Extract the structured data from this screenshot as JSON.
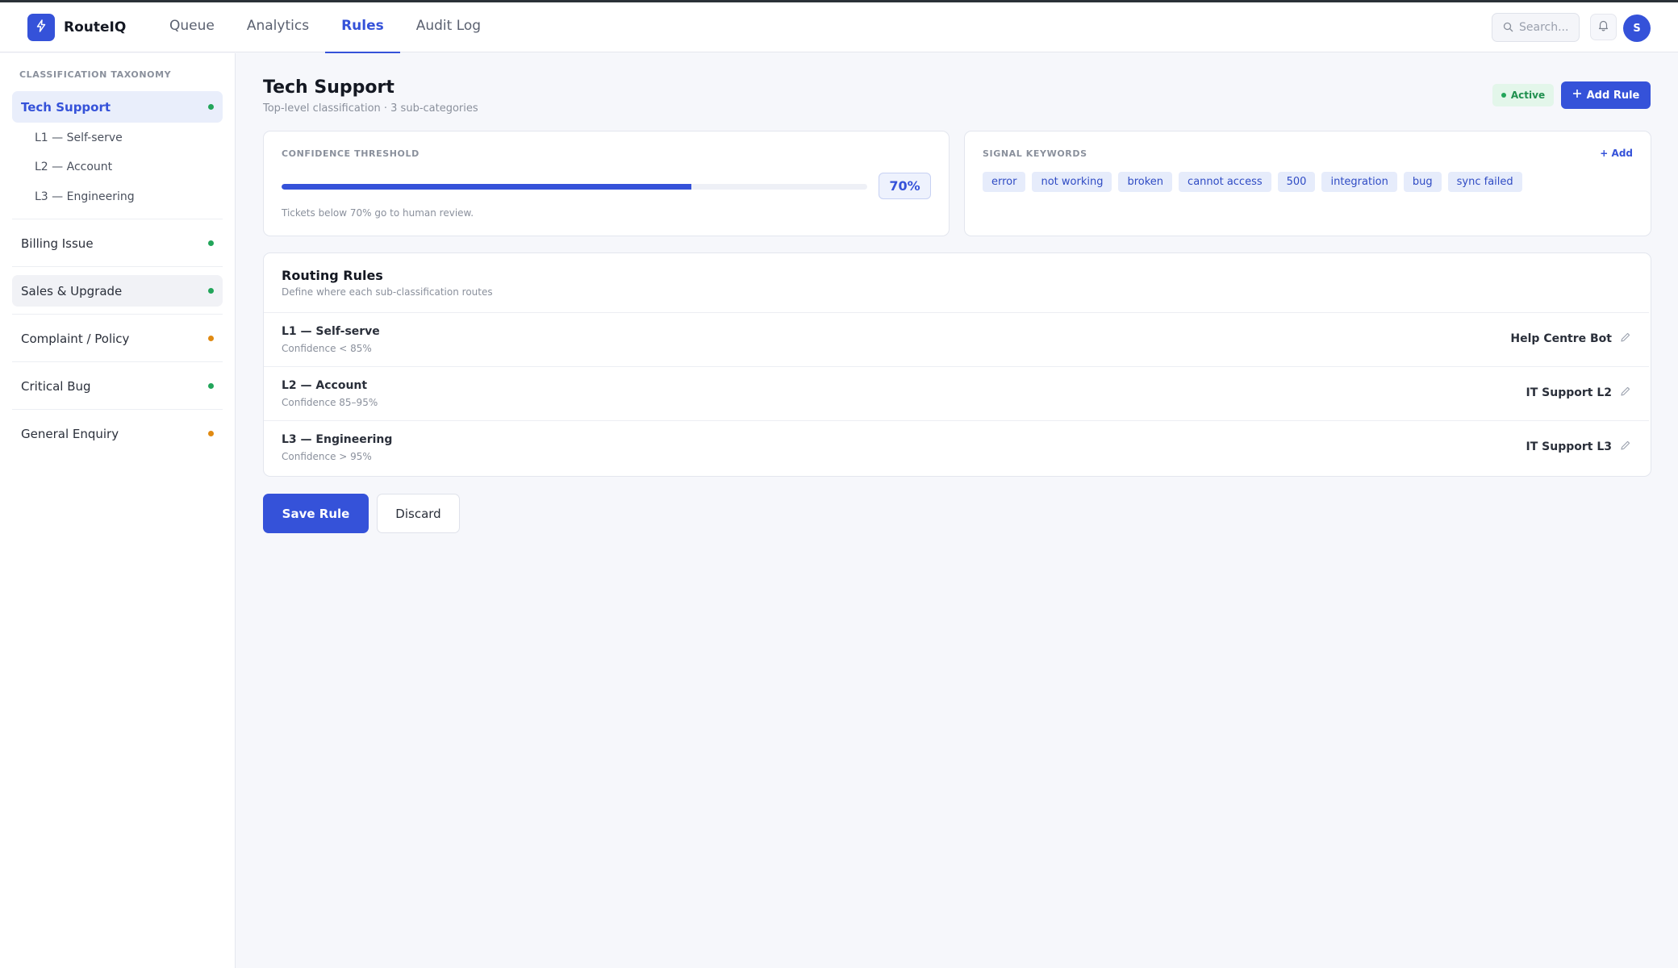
{
  "app": {
    "brand": "RouteIQ"
  },
  "colors": {
    "accent": "#3552d9",
    "active": "#22a55a",
    "warning": "#e08a12"
  },
  "nav": {
    "tabs": [
      {
        "label": "Queue",
        "active": false
      },
      {
        "label": "Analytics",
        "active": false
      },
      {
        "label": "Rules",
        "active": true
      },
      {
        "label": "Audit Log",
        "active": false
      }
    ]
  },
  "header": {
    "search_placeholder": "Search...",
    "avatar_initial": "S",
    "icons": [
      "bolt-icon",
      "search-icon",
      "bell-icon"
    ]
  },
  "sidebar": {
    "heading": "CLASSIFICATION TAXONOMY",
    "items": [
      {
        "label": "Tech Support",
        "status": "green",
        "selected": true,
        "children": [
          "L1 — Self-serve",
          "L2 — Account",
          "L3 — Engineering"
        ]
      },
      {
        "label": "Billing Issue",
        "status": "green"
      },
      {
        "label": "Sales & Upgrade",
        "status": "green"
      },
      {
        "label": "Complaint / Policy",
        "status": "orange"
      },
      {
        "label": "Critical Bug",
        "status": "green"
      },
      {
        "label": "General Enquiry",
        "status": "orange"
      }
    ]
  },
  "main": {
    "title": "Tech Support",
    "subtitle": "Top-level classification · 3 sub-categories",
    "status_badge": "Active",
    "add_rule_label": "Add Rule",
    "threshold": {
      "label": "CONFIDENCE THRESHOLD",
      "value": 70,
      "value_label": "70%",
      "note": "Tickets below 70% go to human review."
    },
    "keywords": {
      "label": "SIGNAL KEYWORDS",
      "add_label": "+ Add",
      "tags": [
        "error",
        "not working",
        "broken",
        "cannot access",
        "500",
        "integration",
        "bug",
        "sync failed"
      ]
    },
    "routing": {
      "title": "Routing Rules",
      "subtitle": "Define where each sub-classification routes",
      "rules": [
        {
          "name": "L1 — Self-serve",
          "condition": "Confidence < 85%",
          "destination": "Help Centre Bot"
        },
        {
          "name": "L2 — Account",
          "condition": "Confidence 85–95%",
          "destination": "IT Support L2"
        },
        {
          "name": "L3 — Engineering",
          "condition": "Confidence > 95%",
          "destination": "IT Support L3"
        }
      ]
    },
    "save_label": "Save Rule",
    "discard_label": "Discard"
  }
}
